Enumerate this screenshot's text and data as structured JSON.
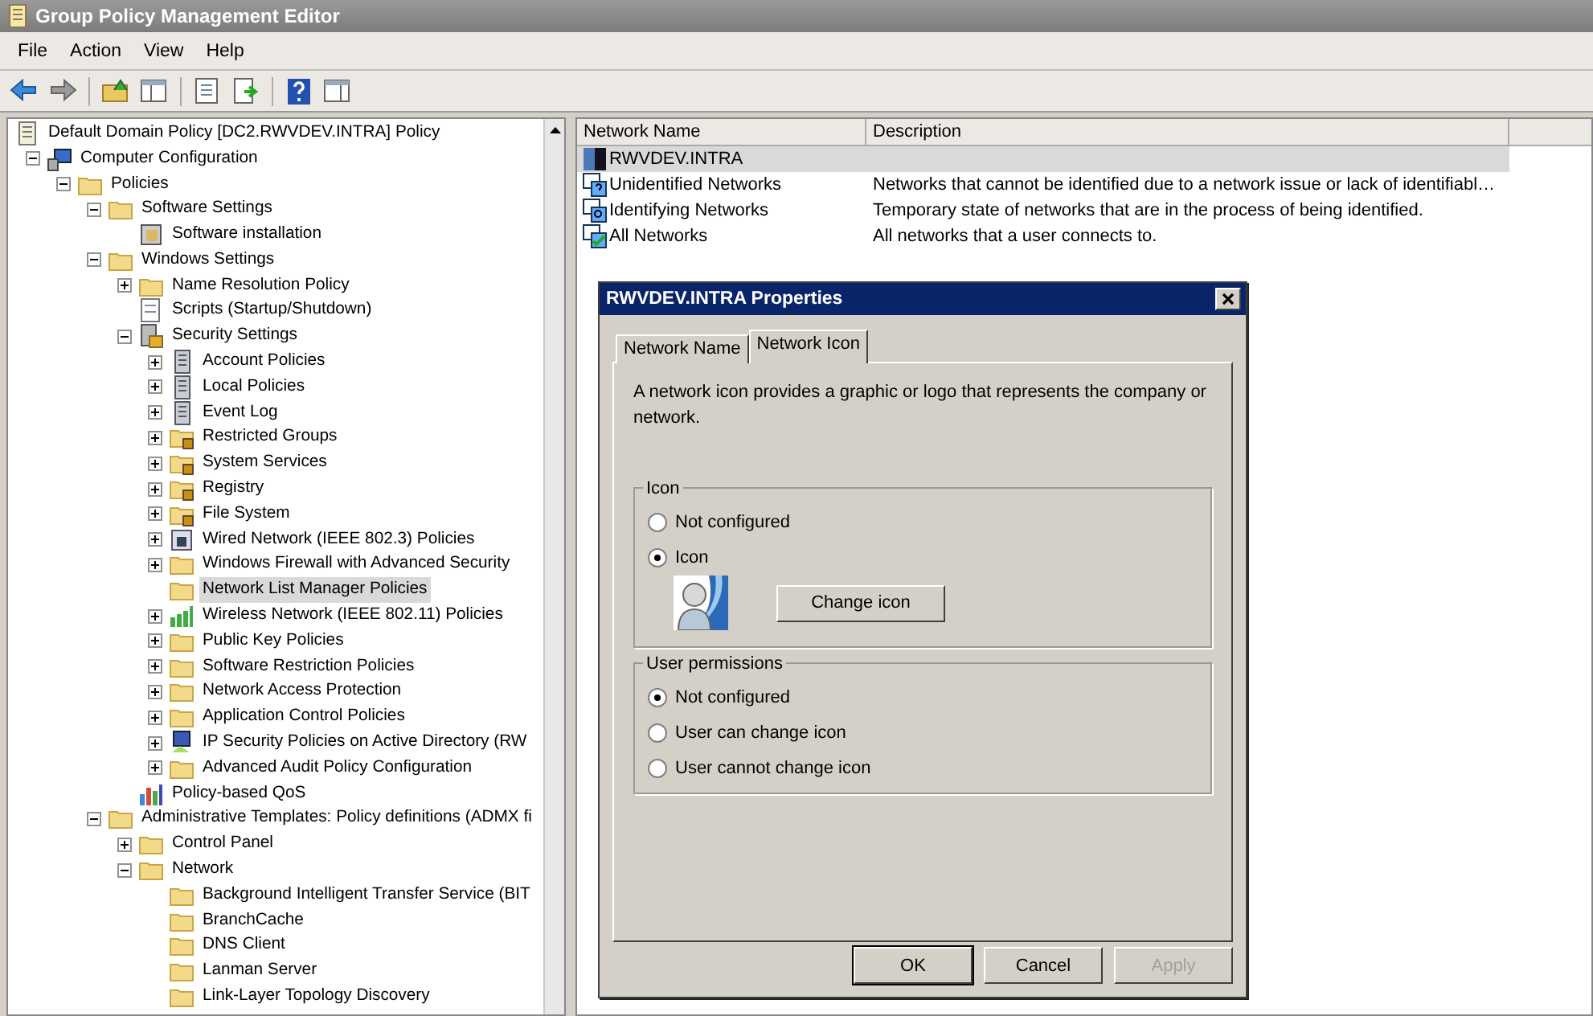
{
  "window": {
    "title": "Group Policy Management Editor"
  },
  "menu": [
    "File",
    "Action",
    "View",
    "Help"
  ],
  "tree": [
    {
      "label": "Default Domain Policy [DC2.RWVDEV.INTRA] Policy",
      "kind": "policy",
      "selected": false,
      "children": [
        {
          "label": "Computer Configuration",
          "kind": "computer",
          "expanded": true,
          "selected": false,
          "children": [
            {
              "label": "Policies",
              "kind": "folder",
              "expanded": true,
              "selected": false,
              "children": [
                {
                  "label": "Software Settings",
                  "kind": "folder",
                  "expanded": true,
                  "selected": false,
                  "children": [
                    {
                      "label": "Software installation",
                      "kind": "install",
                      "selected": false
                    }
                  ]
                },
                {
                  "label": "Windows Settings",
                  "kind": "folder",
                  "expanded": true,
                  "selected": false,
                  "children": [
                    {
                      "label": "Name Resolution Policy",
                      "kind": "folder",
                      "expanded": false,
                      "selected": false
                    },
                    {
                      "label": "Scripts (Startup/Shutdown)",
                      "kind": "script",
                      "selected": false
                    },
                    {
                      "label": "Security Settings",
                      "kind": "security",
                      "expanded": true,
                      "selected": false,
                      "children": [
                        {
                          "label": "Account Policies",
                          "kind": "server",
                          "expanded": false,
                          "selected": false
                        },
                        {
                          "label": "Local Policies",
                          "kind": "server",
                          "expanded": false,
                          "selected": false
                        },
                        {
                          "label": "Event Log",
                          "kind": "server",
                          "expanded": false,
                          "selected": false
                        },
                        {
                          "label": "Restricted Groups",
                          "kind": "lockfolder",
                          "expanded": false,
                          "selected": false
                        },
                        {
                          "label": "System Services",
                          "kind": "lockfolder",
                          "expanded": false,
                          "selected": false
                        },
                        {
                          "label": "Registry",
                          "kind": "lockfolder",
                          "expanded": false,
                          "selected": false
                        },
                        {
                          "label": "File System",
                          "kind": "lockfolder",
                          "expanded": false,
                          "selected": false
                        },
                        {
                          "label": "Wired Network (IEEE 802.3) Policies",
                          "kind": "wired",
                          "expanded": false,
                          "selected": false
                        },
                        {
                          "label": "Windows Firewall with Advanced Security",
                          "kind": "folder",
                          "expanded": false,
                          "selected": false
                        },
                        {
                          "label": "Network List Manager Policies",
                          "kind": "folder",
                          "selected": true
                        },
                        {
                          "label": "Wireless Network (IEEE 802.11) Policies",
                          "kind": "wireless",
                          "expanded": false,
                          "selected": false
                        },
                        {
                          "label": "Public Key Policies",
                          "kind": "folder",
                          "expanded": false,
                          "selected": false
                        },
                        {
                          "label": "Software Restriction Policies",
                          "kind": "folder",
                          "expanded": false,
                          "selected": false
                        },
                        {
                          "label": "Network Access Protection",
                          "kind": "folder",
                          "expanded": false,
                          "selected": false
                        },
                        {
                          "label": "Application Control Policies",
                          "kind": "folder",
                          "expanded": false,
                          "selected": false
                        },
                        {
                          "label": "IP Security Policies on Active Directory (RW",
                          "kind": "ipsec",
                          "expanded": false,
                          "selected": false
                        },
                        {
                          "label": "Advanced Audit Policy Configuration",
                          "kind": "folder",
                          "expanded": false,
                          "selected": false
                        }
                      ]
                    },
                    {
                      "label": "Policy-based QoS",
                      "kind": "chart",
                      "selected": false
                    }
                  ]
                },
                {
                  "label": "Administrative Templates: Policy definitions (ADMX fi",
                  "kind": "folder",
                  "expanded": true,
                  "selected": false,
                  "children": [
                    {
                      "label": "Control Panel",
                      "kind": "folder",
                      "expanded": false,
                      "selected": false
                    },
                    {
                      "label": "Network",
                      "kind": "folder",
                      "expanded": true,
                      "selected": false,
                      "children": [
                        {
                          "label": "Background Intelligent Transfer Service (BIT",
                          "kind": "folder",
                          "selected": false
                        },
                        {
                          "label": "BranchCache",
                          "kind": "folder",
                          "selected": false
                        },
                        {
                          "label": "DNS Client",
                          "kind": "folder",
                          "selected": false
                        },
                        {
                          "label": "Lanman Server",
                          "kind": "folder",
                          "selected": false
                        },
                        {
                          "label": "Link-Layer Topology Discovery",
                          "kind": "folder",
                          "selected": false
                        }
                      ]
                    }
                  ]
                }
              ]
            }
          ]
        }
      ]
    }
  ],
  "list": {
    "columns": [
      "Network Name",
      "Description"
    ],
    "rows": [
      {
        "name": "RWVDEV.INTRA",
        "kind": "custom",
        "selected": true
      },
      {
        "name": "Unidentified Networks",
        "description": "Networks that cannot be identified due to a network issue or lack of identifiabl…",
        "kind": "unknown",
        "selected": false
      },
      {
        "name": "Identifying Networks",
        "description": "Temporary state of networks that are in the process of being identified.",
        "kind": "searching",
        "selected": false
      },
      {
        "name": "All Networks",
        "description": "All networks that a user connects to.",
        "kind": "all",
        "selected": false
      }
    ]
  },
  "dialog": {
    "title": "RWVDEV.INTRA Properties",
    "tabs": [
      {
        "label": "Network Name",
        "selected": false
      },
      {
        "label": "Network Icon",
        "selected": true
      }
    ],
    "intro": "A network icon provides a graphic or logo that represents the company or network.",
    "groups": [
      {
        "title": "Icon",
        "options": [
          {
            "label": "Not configured",
            "selected": false
          },
          {
            "label": "Icon",
            "selected": true
          }
        ],
        "button": "Change icon",
        "preview": {
          "kind": "picture"
        }
      },
      {
        "title": "User permissions",
        "options": [
          {
            "label": "Not configured",
            "selected": true
          },
          {
            "label": "User can change icon",
            "selected": false
          },
          {
            "label": "User cannot change icon",
            "selected": false
          }
        ]
      }
    ],
    "buttons": [
      {
        "label": "OK",
        "default": true,
        "disabled": false
      },
      {
        "label": "Cancel",
        "default": false,
        "disabled": false
      },
      {
        "label": "Apply",
        "default": false,
        "disabled": true
      }
    ]
  }
}
